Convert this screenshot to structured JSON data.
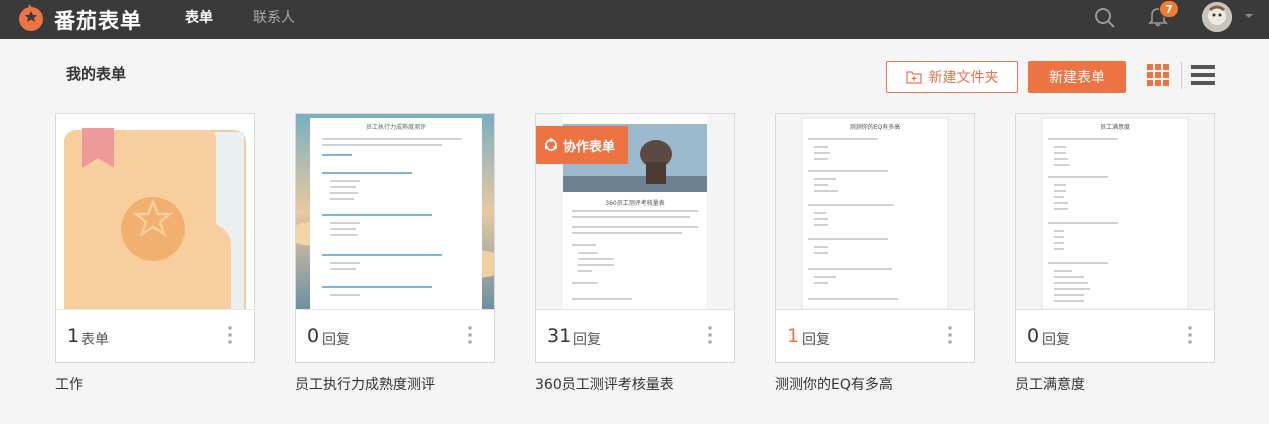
{
  "app": {
    "brand": "番茄表单",
    "nav": [
      {
        "label": "表单",
        "active": true
      },
      {
        "label": "联系人",
        "active": false
      }
    ],
    "notifications_count": "7",
    "icons": {
      "logo": "tomato-logo-icon",
      "search": "search-icon",
      "bell": "bell-icon",
      "avatar": "avatar",
      "caret": "chevron-down-icon"
    }
  },
  "page": {
    "title": "我的表单",
    "new_folder_label": "新建文件夹",
    "new_form_label": "新建表单",
    "accent_color": "#ed7442"
  },
  "cards": [
    {
      "name": "工作",
      "count": "1",
      "unit": "表单",
      "kind": "folder"
    },
    {
      "name": "员工执行力成熟度测评",
      "count": "0",
      "unit": "回复",
      "kind": "form",
      "preview_title": "员工执行力成熟度测评"
    },
    {
      "name": "360员工测评考核量表",
      "count": "31",
      "unit": "回复",
      "kind": "form",
      "ribbon": "协作表单",
      "preview_title": "360员工测评考核量表"
    },
    {
      "name": "测测你的EQ有多高",
      "count": "1",
      "unit": "回复",
      "kind": "form",
      "preview_title": "测测你的EQ有多高"
    },
    {
      "name": "员工满意度",
      "count": "0",
      "unit": "回复",
      "kind": "form",
      "preview_title": "员工满意度"
    }
  ]
}
